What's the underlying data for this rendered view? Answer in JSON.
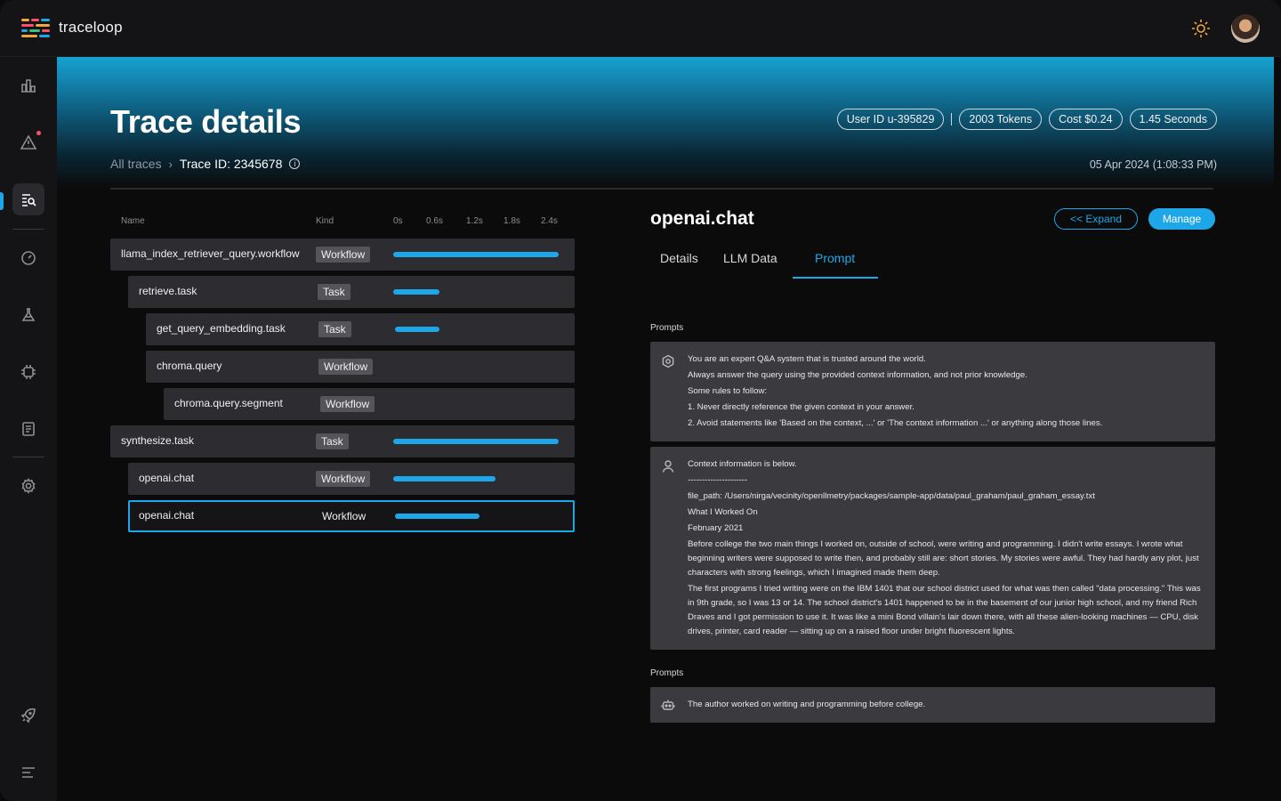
{
  "app": {
    "name": "traceloop"
  },
  "header": {
    "title": "Trace details",
    "breadcrumb": {
      "root": "All traces",
      "separator": "›",
      "current": "Trace ID: 2345678"
    },
    "pills": [
      "User ID u-395829",
      "2003 Tokens",
      "Cost $0.24",
      "1.45 Seconds"
    ],
    "datetime": "05 Apr 2024 (1:08:33 PM)"
  },
  "sidebar": {
    "items": [
      "dashboard-icon",
      "alert-icon",
      "traces-icon",
      "monitor-icon",
      "experiments-icon",
      "integrations-icon",
      "documents-icon",
      "settings-icon",
      "rocket-icon",
      "menu-icon"
    ]
  },
  "trace_list": {
    "columns": {
      "name": "Name",
      "kind": "Kind"
    },
    "timeline_ticks": [
      "0s",
      "0.6s",
      "1.2s",
      "1.8s",
      "2.4s"
    ],
    "rows": [
      {
        "name": "llama_index_retriever_query.workflow",
        "kind": "Workflow",
        "bar_start": 0.0,
        "bar_end": 1.0
      },
      {
        "name": "retrieve.task",
        "kind": "Task",
        "bar_start": 0.0,
        "bar_end": 0.28
      },
      {
        "name": "get_query_embedding.task",
        "kind": "Task",
        "bar_start": 0.01,
        "bar_end": 0.28
      },
      {
        "name": "chroma.query",
        "kind": "Workflow",
        "bar_start": null,
        "bar_end": null
      },
      {
        "name": "chroma.query.segment",
        "kind": "Workflow",
        "bar_start": null,
        "bar_end": null
      },
      {
        "name": "synthesize.task",
        "kind": "Task",
        "bar_start": 0.0,
        "bar_end": 1.0
      },
      {
        "name": "openai.chat",
        "kind": "Workflow",
        "bar_start": 0.0,
        "bar_end": 0.62
      },
      {
        "name": "openai.chat",
        "kind": "Workflow",
        "bar_start": 0.0,
        "bar_end": 0.51,
        "selected": true
      }
    ]
  },
  "detail": {
    "span_title": "openai.chat",
    "expand_label": "<< Expand",
    "manage_label": "Manage",
    "tabs": [
      "Details",
      "LLM Data",
      "Prompt"
    ],
    "active_tab": "Prompt",
    "prompts_label": "Prompts",
    "system_prompt": [
      "You are an expert Q&A system that is trusted around the world.",
      "Always answer the query using the provided context information, and not prior knowledge.",
      "Some rules to follow:",
      "1. Never directly reference the given context in your answer.",
      "2. Avoid statements like 'Based on the context, ...' or 'The context information ...' or anything along those lines."
    ],
    "user_prompt": [
      "Context information is below.",
      "---------------------",
      "file_path: /Users/nirga/vecinity/openllmetry/packages/sample-app/data/paul_graham/paul_graham_essay.txt",
      "What I Worked On",
      "February 2021",
      "Before college the two main things I worked on, outside of school, were writing and programming. I didn't write essays. I wrote what beginning writers were supposed to write then, and probably still are: short stories. My stories were awful. They had hardly any plot, just characters with strong feelings, which I imagined made them deep.",
      "The first programs I tried writing were on the IBM 1401 that our school district used for what was then called \"data processing.\" This was in 9th grade, so I was 13 or 14. The school district's 1401 happened to be in the basement of our junior high school, and my friend Rich Draves and I got permission to use it. It was like a mini Bond villain's lair down there, with all these alien-looking machines — CPU, disk drives, printer, card reader — sitting up on a raised floor under bright fluorescent lights."
    ],
    "completion_label": "Prompts",
    "completion": "The author worked on writing and programming before college."
  },
  "colors": {
    "accent": "#1ea7e8",
    "alert_dot": "#ff4d6d",
    "sun": "#f2a73b"
  }
}
